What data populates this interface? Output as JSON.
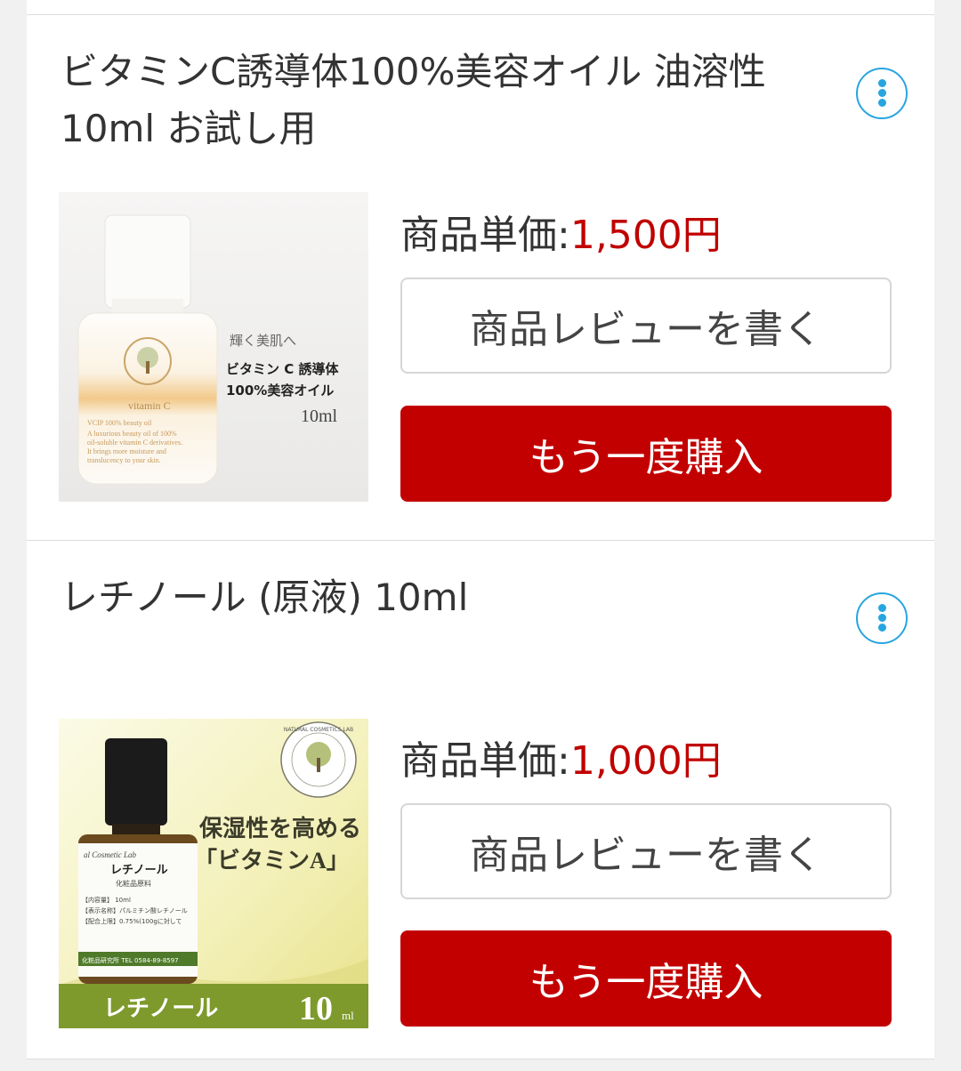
{
  "products": [
    {
      "title": "ビタミンC誘導体100%美容オイル 油溶性 10ml お試し用",
      "price_label": "商品単価:",
      "price_value": "1,500円",
      "review_button": "商品レビューを書く",
      "buy_button": "もう一度購入",
      "image": {
        "tagline": "輝く美肌へ",
        "name_line1": "ビタミン C 誘導体",
        "name_line2": "100%美容オイル",
        "volume": "10ml",
        "bottle_brand": "vitamin C",
        "bottle_text1": "VCIP 100% beauty oil",
        "bottle_text2": "A luxurious beauty oil of 100%",
        "bottle_text3": "oil-soluble vitamin C derivatives.",
        "bottle_text4": "It brings more moisture and",
        "bottle_text5": "translucency to your skin."
      }
    },
    {
      "title": "レチノール (原液) 10ml",
      "price_label": "商品単価:",
      "price_value": "1,000円",
      "review_button": "商品レビューを書く",
      "buy_button": "もう一度購入",
      "image": {
        "headline1": "保湿性を高める",
        "headline2": "「ビタミンA」",
        "footer_name": "レチノール",
        "footer_volume": "10",
        "footer_unit": "ml",
        "seal_text": "NATURAL COSMETICS LAB",
        "label_brand": "al Cosmetic Lab",
        "label_name": "レチノール",
        "label_sub": "化粧品原料",
        "label_line1": "【内容量】 10ml",
        "label_line2": "【表示名称】パルミチン酸レチノール",
        "label_line3": "【配合上限】0.75%(100gに対して",
        "label_footer": "化粧品研究所 TEL 0584-89-8597"
      }
    }
  ],
  "colors": {
    "accent": "#27a5e0",
    "price": "#c00000",
    "buy_button": "#c30000"
  }
}
